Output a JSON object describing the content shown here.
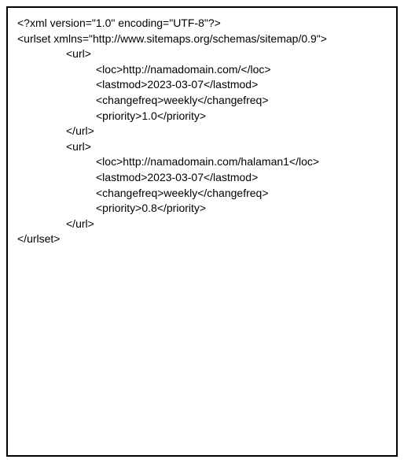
{
  "xml": {
    "declaration": "<?xml version=\"1.0\" encoding=\"UTF-8\"?>",
    "urlset_open": "<urlset xmlns=\"http://www.sitemaps.org/schemas/sitemap/0.9\">",
    "url_open": "<url>",
    "url_close": "</url>",
    "urlset_close": "</urlset>",
    "entries": [
      {
        "loc": "<loc>http://namadomain.com/</loc>",
        "lastmod": "<lastmod>2023-03-07</lastmod>",
        "changefreq": "<changefreq>weekly</changefreq>",
        "priority": "<priority>1.0</priority>"
      },
      {
        "loc": "<loc>http://namadomain.com/halaman1</loc>",
        "lastmod": "<lastmod>2023-03-07</lastmod>",
        "changefreq": "<changefreq>weekly</changefreq>",
        "priority": "<priority>0.8</priority>"
      }
    ]
  }
}
